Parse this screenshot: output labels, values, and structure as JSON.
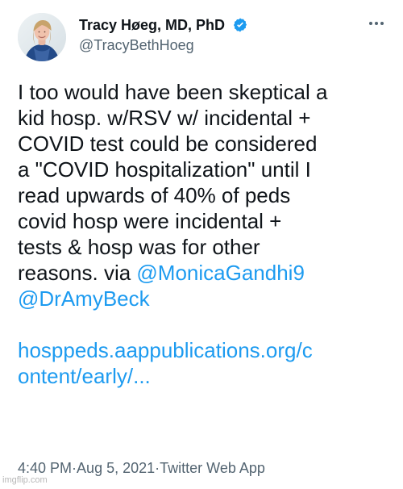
{
  "profile": {
    "display_name": "Tracy Høeg, MD, PhD",
    "handle": "@TracyBethHoeg",
    "verified": true,
    "avatar_icon": "person-avatar-icon",
    "more_icon": "more-horizontal-icon"
  },
  "tweet": {
    "lines": [
      "I too would have been skeptical a",
      "kid hosp. w/RSV w/ incidental +",
      "COVID test could be considered",
      "a \"COVID hospitalization\" until I",
      "read upwards of 40% of peds",
      "covid hosp were incidental +",
      "tests & hosp was for other",
      "reasons. via "
    ],
    "mentions": [
      "@MonicaGandhi9",
      "@DrAmyBeck"
    ],
    "link_lines": [
      "hosppeds.aappublications.org/c",
      "ontent/early/..."
    ]
  },
  "meta": {
    "time": "4:40 PM",
    "separator_1": " · ",
    "date": "Aug 5, 2021",
    "separator_2": " · ",
    "source": "Twitter Web App"
  },
  "watermark": "imgflip.com",
  "colors": {
    "text": "#0f1419",
    "secondary": "#536471",
    "link": "#1d9bf0",
    "verified": "#1d9bf0"
  }
}
